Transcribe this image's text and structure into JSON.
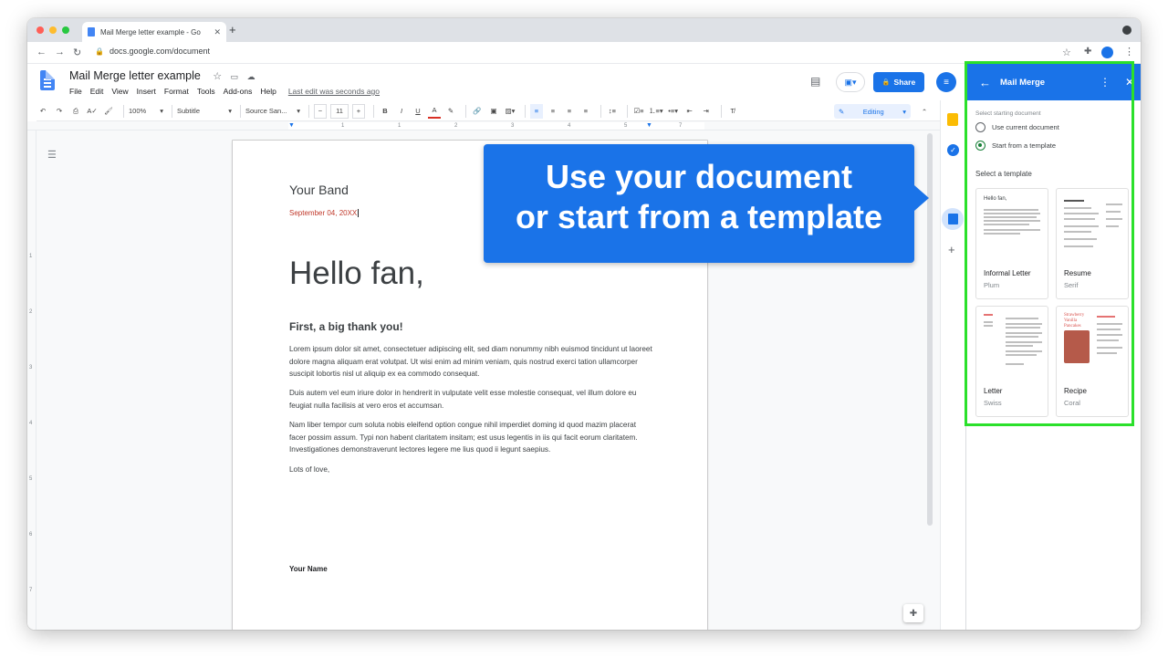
{
  "browser": {
    "tab_title": "Mail Merge letter example - Go",
    "url": "docs.google.com/document"
  },
  "doc": {
    "title": "Mail Merge letter example",
    "menus": [
      "File",
      "Edit",
      "View",
      "Insert",
      "Format",
      "Tools",
      "Add-ons",
      "Help"
    ],
    "last_edit": "Last edit was seconds ago",
    "share_label": "Share"
  },
  "toolbar": {
    "zoom": "100%",
    "style": "Subtitle",
    "font": "Source San...",
    "font_size": "11",
    "mode": "Editing"
  },
  "page": {
    "band": "Your Band",
    "date": "September 04, 20XX",
    "greeting": "Hello fan,",
    "heading": "First, a big thank you!",
    "p1": "Lorem ipsum dolor sit amet, consectetuer adipiscing elit, sed diam nonummy nibh euismod tincidunt ut laoreet dolore magna aliquam erat volutpat. Ut wisi enim ad minim veniam, quis nostrud exerci tation ullamcorper suscipit lobortis nisl ut aliquip ex ea commodo consequat.",
    "p2": "Duis autem vel eum iriure dolor in hendrerit in vulputate velit esse molestie consequat, vel illum dolore eu feugiat nulla facilisis at vero eros et accumsan.",
    "p3": "Nam liber tempor cum soluta nobis eleifend option congue nihil imperdiet doming id quod mazim placerat facer possim assum. Typi non habent claritatem insitam; est usus legentis in iis qui facit eorum claritatem. Investigationes demonstraverunt lectores legere me lius quod ii legunt saepius.",
    "closing": "Lots of love,",
    "signature": "Your Name"
  },
  "callout": {
    "line1": "Use your document",
    "line2": "or start from a template"
  },
  "panel": {
    "title": "Mail Merge",
    "section_label": "Select starting document",
    "option1": "Use current document",
    "option2": "Start from a template",
    "selected_option": "Start from a template",
    "template_heading": "Select a template",
    "templates": [
      {
        "name": "Informal Letter",
        "sub": "Plum"
      },
      {
        "name": "Resume",
        "sub": "Serif"
      },
      {
        "name": "Letter",
        "sub": "Swiss"
      },
      {
        "name": "Recipe",
        "sub": "Coral"
      }
    ],
    "thumb_text_informal": "Hello fan,",
    "thumb_text_recipe": "Strawberry Vanilla Pancakes"
  },
  "ruler_numbers": [
    "1",
    "1",
    "2",
    "3",
    "4",
    "5",
    "6",
    "7"
  ],
  "vruler_numbers": [
    "1",
    "2",
    "3",
    "4",
    "5",
    "6",
    "7"
  ],
  "colors": {
    "accent": "#1a73e8",
    "highlight": "#2be02b",
    "date_text": "#c0392b"
  }
}
